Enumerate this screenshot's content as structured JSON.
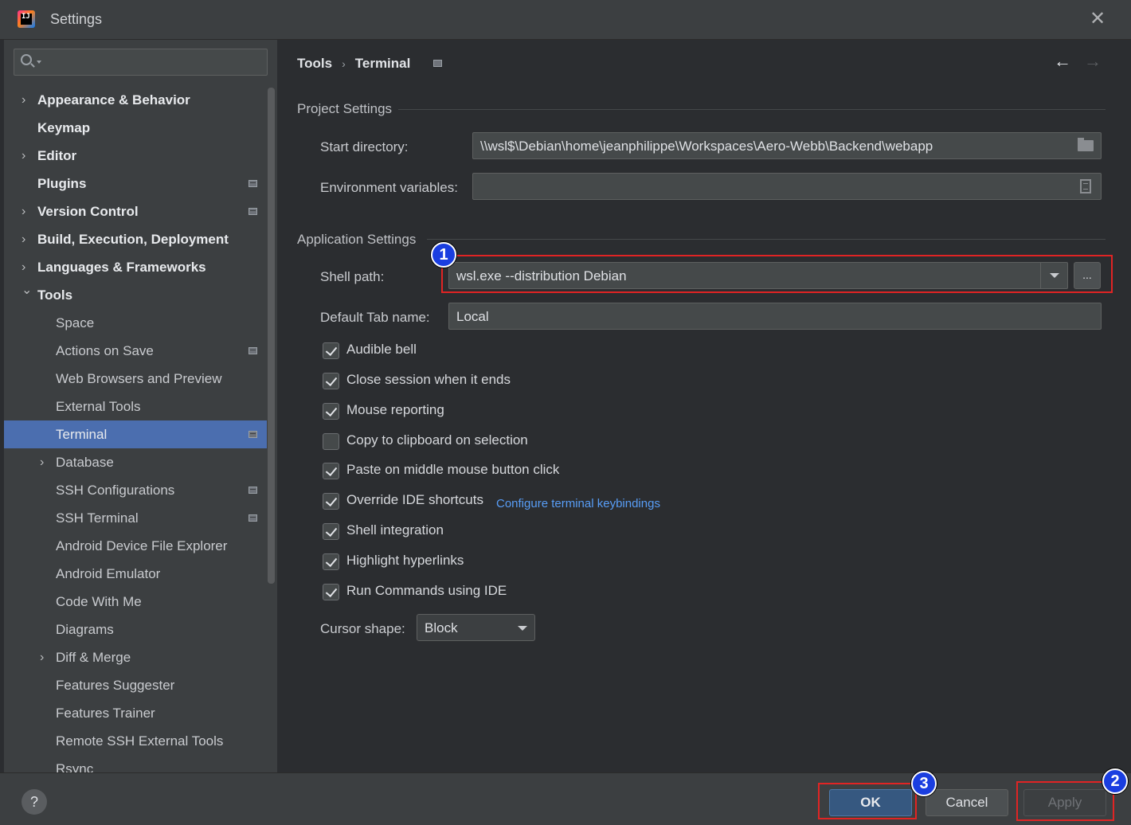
{
  "window": {
    "title": "Settings",
    "close_glyph": "✕",
    "logo_text": "IJ"
  },
  "sidebar": {
    "search_placeholder": "",
    "items": [
      {
        "label": "Appearance & Behavior",
        "level": "top",
        "expandable": true,
        "expanded": false,
        "badge": false
      },
      {
        "label": "Keymap",
        "level": "top",
        "expandable": false,
        "badge": false
      },
      {
        "label": "Editor",
        "level": "top",
        "expandable": true,
        "expanded": false,
        "badge": false
      },
      {
        "label": "Plugins",
        "level": "top",
        "expandable": false,
        "badge": true
      },
      {
        "label": "Version Control",
        "level": "top",
        "expandable": true,
        "expanded": false,
        "badge": true
      },
      {
        "label": "Build, Execution, Deployment",
        "level": "top",
        "expandable": true,
        "expanded": false,
        "badge": false
      },
      {
        "label": "Languages & Frameworks",
        "level": "top",
        "expandable": true,
        "expanded": false,
        "badge": false
      },
      {
        "label": "Tools",
        "level": "top",
        "expandable": true,
        "expanded": true,
        "badge": false
      },
      {
        "label": "Space",
        "level": "sub",
        "badge": false
      },
      {
        "label": "Actions on Save",
        "level": "sub",
        "badge": true
      },
      {
        "label": "Web Browsers and Preview",
        "level": "sub",
        "badge": false
      },
      {
        "label": "External Tools",
        "level": "sub",
        "badge": false
      },
      {
        "label": "Terminal",
        "level": "sub",
        "badge": true,
        "selected": true
      },
      {
        "label": "Database",
        "level": "sub",
        "expandable": true,
        "badge": false
      },
      {
        "label": "SSH Configurations",
        "level": "sub",
        "badge": true
      },
      {
        "label": "SSH Terminal",
        "level": "sub",
        "badge": true
      },
      {
        "label": "Android Device File Explorer",
        "level": "sub",
        "badge": false
      },
      {
        "label": "Android Emulator",
        "level": "sub",
        "badge": false
      },
      {
        "label": "Code With Me",
        "level": "sub",
        "badge": false
      },
      {
        "label": "Diagrams",
        "level": "sub",
        "badge": false
      },
      {
        "label": "Diff & Merge",
        "level": "sub",
        "expandable": true,
        "badge": false
      },
      {
        "label": "Features Suggester",
        "level": "sub",
        "badge": false
      },
      {
        "label": "Features Trainer",
        "level": "sub",
        "badge": false
      },
      {
        "label": "Remote SSH External Tools",
        "level": "sub",
        "badge": false
      },
      {
        "label": "Rsync",
        "level": "sub",
        "badge": false
      }
    ]
  },
  "breadcrumb": {
    "parent": "Tools",
    "separator": "›",
    "current": "Terminal",
    "back_glyph": "←",
    "forward_glyph": "→"
  },
  "project_settings": {
    "title": "Project Settings",
    "start_directory_label": "Start directory:",
    "start_directory_value": "\\\\wsl$\\Debian\\home\\jeanphilippe\\Workspaces\\Aero-Webb\\Backend\\webapp",
    "env_vars_label": "Environment variables:",
    "env_vars_value": ""
  },
  "application_settings": {
    "title": "Application Settings",
    "shell_path_label": "Shell path:",
    "shell_path_value": "wsl.exe --distribution Debian",
    "browse_label": "...",
    "default_tab_label": "Default Tab name:",
    "default_tab_value": "Local",
    "checkboxes": [
      {
        "label": "Audible bell",
        "checked": true
      },
      {
        "label": "Close session when it ends",
        "checked": true
      },
      {
        "label": "Mouse reporting",
        "checked": true
      },
      {
        "label": "Copy to clipboard on selection",
        "checked": false
      },
      {
        "label": "Paste on middle mouse button click",
        "checked": true
      },
      {
        "label": "Override IDE shortcuts",
        "checked": true
      },
      {
        "label": "Shell integration",
        "checked": true
      },
      {
        "label": "Highlight hyperlinks",
        "checked": true
      },
      {
        "label": "Run Commands using IDE",
        "checked": true
      }
    ],
    "keybindings_link": "Configure terminal keybindings",
    "cursor_shape_label": "Cursor shape:",
    "cursor_shape_value": "Block"
  },
  "callouts": {
    "one": "1",
    "two": "2",
    "three": "3",
    "color_box": "#e02424",
    "color_badge": "#1a3ee0"
  },
  "footer": {
    "help_glyph": "?",
    "ok_label": "OK",
    "cancel_label": "Cancel",
    "apply_label": "Apply"
  },
  "colors": {
    "selection": "#4b6eaf",
    "link": "#589df6",
    "ok_button": "#365880"
  }
}
